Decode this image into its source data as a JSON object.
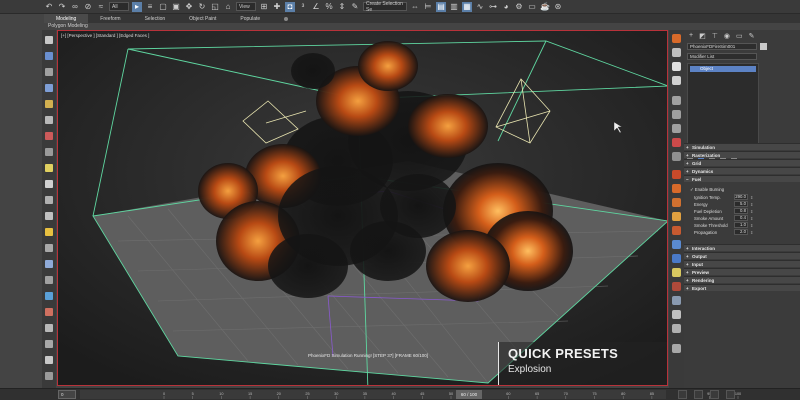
{
  "toolbar": {
    "select_filter": "All",
    "view_dropdown": "View",
    "named_selection": "Create Selection Se"
  },
  "ribbon": {
    "tabs": [
      {
        "label": "Modeling",
        "active": true
      },
      {
        "label": "Freeform",
        "active": false
      },
      {
        "label": "Selection",
        "active": false
      },
      {
        "label": "Object Paint",
        "active": false
      },
      {
        "label": "Populate",
        "active": false
      }
    ],
    "sub_label": "Polygon Modeling"
  },
  "viewport": {
    "label": "[+] [Perspective ] [Standard ] [Edged Faces ]",
    "status": "PhoenixFD Simulation Running! [STEP 37] [FRAME 60/100]",
    "preset_title": "QUICK PRESETS",
    "preset_subtitle": "Explosion"
  },
  "command_panel": {
    "object_name": "PhoenixFDFireSim001",
    "modifier_list": "Modifier List",
    "stack_item": "Object",
    "rollouts_top": [
      "Simulation",
      "Rasterization",
      "Grid",
      "Dynamics",
      "Fuel"
    ],
    "fuel": {
      "enable_burning": "Enable Burning",
      "params": [
        {
          "label": "Ignition Temp.",
          "value": "290.0"
        },
        {
          "label": "Energy",
          "value": "5.0"
        },
        {
          "label": "Fuel Depletion",
          "value": "0.8"
        },
        {
          "label": "Smoke Amount",
          "value": "0.4"
        },
        {
          "label": "Smoke Threshold",
          "value": "1.0"
        },
        {
          "label": "Propagation",
          "value": "2.0"
        }
      ]
    },
    "rollouts_bottom": [
      "Interaction",
      "Output",
      "Input",
      "Preview",
      "Rendering",
      "Export"
    ]
  },
  "timeline": {
    "frame_box": "0",
    "slider": "60 / 100",
    "ticks": [
      "0",
      "5",
      "10",
      "15",
      "20",
      "25",
      "30",
      "35",
      "40",
      "45",
      "50",
      "55",
      "60",
      "65",
      "70",
      "75",
      "80",
      "85",
      "90",
      "95",
      "100"
    ]
  },
  "colors": {
    "viewport_border": "#b8323a",
    "box_lines": "#5fd6a0",
    "stack_highlight": "#5c82c4",
    "fire": "#e07a26"
  }
}
